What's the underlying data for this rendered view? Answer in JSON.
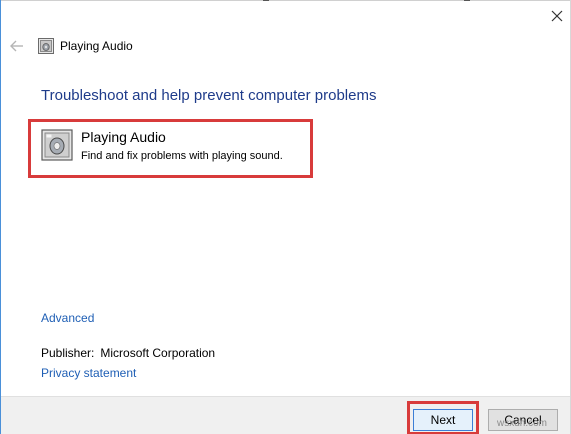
{
  "window": {
    "title": "Playing Audio",
    "close_icon": "close-icon",
    "back_icon": "back-arrow-icon"
  },
  "main": {
    "headline": "Troubleshoot and help prevent computer problems",
    "item": {
      "title": "Playing Audio",
      "description": "Find and fix problems with playing sound.",
      "icon": "speaker-icon"
    },
    "advanced_link": "Advanced",
    "publisher_label": "Publisher:",
    "publisher_value": "Microsoft Corporation",
    "privacy_link": "Privacy statement"
  },
  "footer": {
    "next_label": "Next",
    "cancel_label": "Cancel"
  },
  "watermark": "wsxdn.com",
  "colors": {
    "headline": "#1e3b8a",
    "link": "#1f5fb5",
    "highlight": "#d83b3b",
    "window_border": "#4a90d9"
  }
}
